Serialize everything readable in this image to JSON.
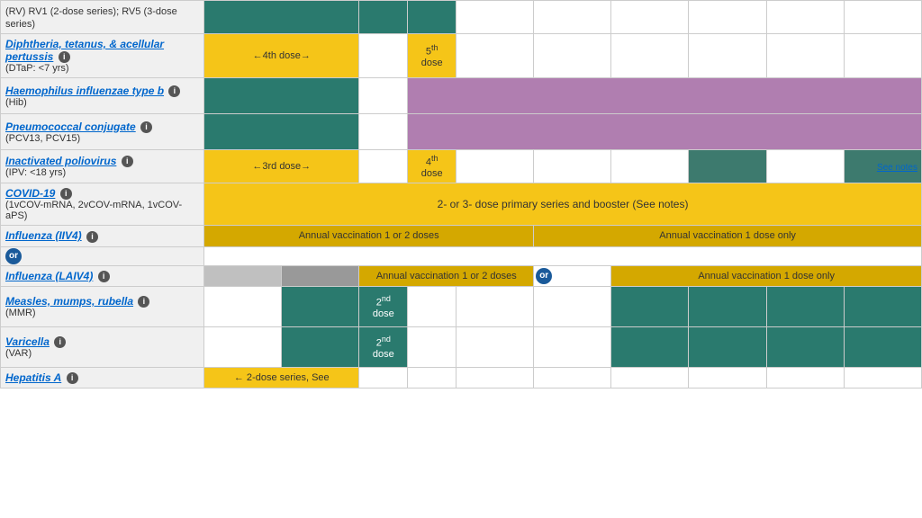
{
  "vaccines": [
    {
      "id": "rv",
      "nameLink": "(RV) RV1 (2-dose series); RV5 (3-dose series)",
      "isLink": false,
      "sub": "",
      "rowType": "partial-top"
    },
    {
      "id": "dtap",
      "nameLink": "Diphtheria, tetanus, & acellular pertussis",
      "isLink": true,
      "sub": "(DTaP: <7 yrs)",
      "info": true
    },
    {
      "id": "hib",
      "nameLink": "Haemophilus influenzae type b",
      "isLink": true,
      "sub": "(Hib)",
      "info": true,
      "italic": true
    },
    {
      "id": "pcv",
      "nameLink": "Pneumococcal conjugate",
      "isLink": true,
      "sub": "(PCV13, PCV15)",
      "info": true
    },
    {
      "id": "ipv",
      "nameLink": "Inactivated poliovirus",
      "isLink": true,
      "sub": "(IPV: <18 yrs)",
      "info": true
    },
    {
      "id": "covid",
      "nameLink": "COVID-19",
      "isLink": true,
      "sub": "(1vCOV-mRNA, 2vCOV-mRNA, 1vCOV-aPS)",
      "info": true
    },
    {
      "id": "flu-iiv4",
      "nameLink": "Influenza (IIV4)",
      "isLink": true,
      "sub": "",
      "info": true
    },
    {
      "id": "flu-laiv4",
      "nameLink": "Influenza (LAIV4)",
      "isLink": true,
      "sub": "",
      "info": true
    },
    {
      "id": "mmr",
      "nameLink": "Measles, mumps, rubella",
      "isLink": true,
      "sub": "(MMR)",
      "info": true
    },
    {
      "id": "var",
      "nameLink": "Varicella",
      "isLink": true,
      "sub": "(VAR)",
      "info": true
    },
    {
      "id": "hepa",
      "nameLink": "Hepatitis A",
      "isLink": true,
      "sub": "",
      "info": true
    }
  ],
  "labels": {
    "4th_dose": "←4th dose→",
    "5th_dose_sup": "th",
    "5th_dose": "5",
    "dose": "dose",
    "3rd_dose": "←3rd dose→",
    "4th_dose_plain": "4",
    "4th_dose_plain_sup": "th",
    "2nd_dose": "2",
    "2nd_dose_sup": "nd",
    "covid_text": "2- or 3- dose primary series and booster (See notes)",
    "notes_link": "notes",
    "annual_1or2": "Annual vaccination 1 or 2 doses",
    "annual_1only": "Annual vaccination 1 dose only",
    "annual_1or2_b": "Annual vaccination 1 or 2 doses",
    "annual_1only_b": "Annual vaccination 1 dose only",
    "see_notes": "See notes",
    "hepa_text": "← 2-dose series, See",
    "or_label": "or"
  }
}
